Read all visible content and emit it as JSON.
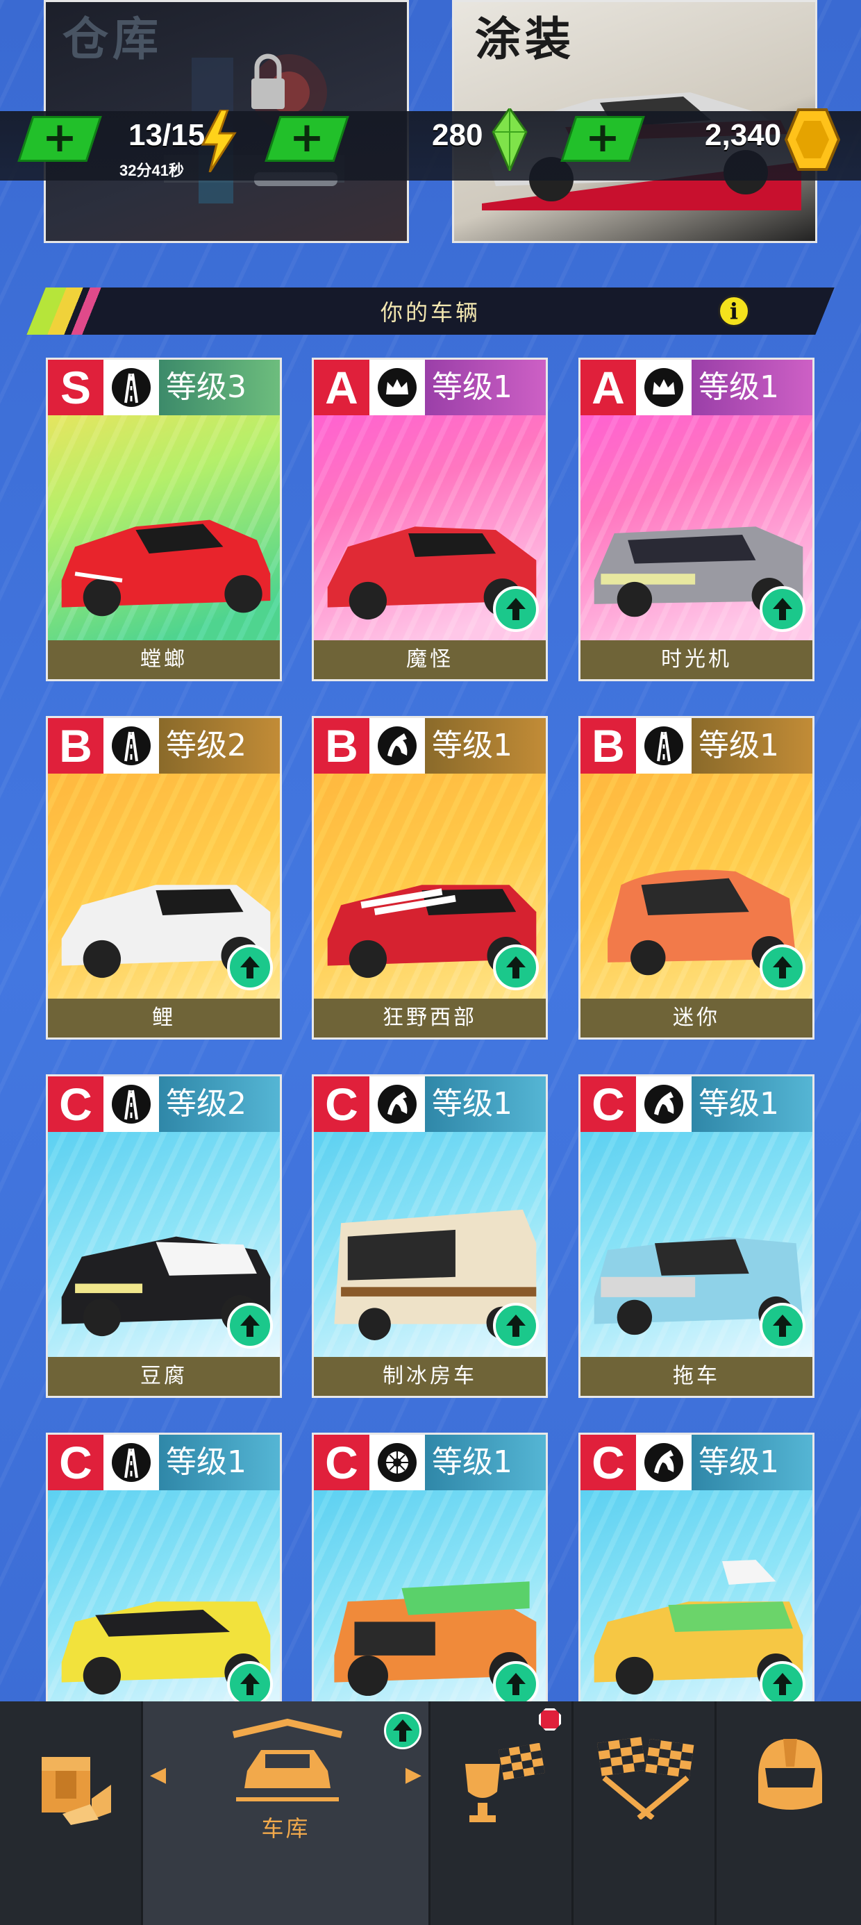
{
  "top_tiles": {
    "warehouse_title": "仓库",
    "paint_title": "涂装"
  },
  "resources": {
    "energy": "13/15",
    "energy_timer": "32分41秒",
    "gems": "280",
    "coins": "2,340"
  },
  "section": {
    "title": "你的车辆"
  },
  "cars": [
    {
      "grade": "S",
      "level": "等级3",
      "name": "螳螂",
      "type_icon": "road-icon",
      "bg": "yellow-green",
      "upgrade": false
    },
    {
      "grade": "A",
      "level": "等级1",
      "name": "魔怪",
      "type_icon": "crown-icon",
      "bg": "pink",
      "upgrade": true
    },
    {
      "grade": "A",
      "level": "等级1",
      "name": "时光机",
      "type_icon": "crown-icon",
      "bg": "pink",
      "upgrade": true
    },
    {
      "grade": "B",
      "level": "等级2",
      "name": "鲤",
      "type_icon": "road-icon",
      "bg": "orange",
      "upgrade": true
    },
    {
      "grade": "B",
      "level": "等级1",
      "name": "狂野西部",
      "type_icon": "horse-icon",
      "bg": "orange",
      "upgrade": true
    },
    {
      "grade": "B",
      "level": "等级1",
      "name": "迷你",
      "type_icon": "road-icon",
      "bg": "orange",
      "upgrade": true
    },
    {
      "grade": "C",
      "level": "等级2",
      "name": "豆腐",
      "type_icon": "road-icon",
      "bg": "blue",
      "upgrade": true
    },
    {
      "grade": "C",
      "level": "等级1",
      "name": "制冰房车",
      "type_icon": "horse-icon",
      "bg": "blue",
      "upgrade": true
    },
    {
      "grade": "C",
      "level": "等级1",
      "name": "拖车",
      "type_icon": "horse-icon",
      "bg": "blue",
      "upgrade": true
    },
    {
      "grade": "C",
      "level": "等级1",
      "name": "",
      "type_icon": "road-icon",
      "bg": "blue",
      "upgrade": true
    },
    {
      "grade": "C",
      "level": "等级1",
      "name": "",
      "type_icon": "tire-icon",
      "bg": "blue",
      "upgrade": true
    },
    {
      "grade": "C",
      "level": "等级1",
      "name": "",
      "type_icon": "horse-icon",
      "bg": "blue",
      "upgrade": true
    }
  ],
  "nav": {
    "garage_label": "车库"
  },
  "colors": {
    "background": "#3d6fd6",
    "grade_red": "#e0203b",
    "upgrade_green": "#1bc88b",
    "nav_accent": "#f2a94b"
  }
}
